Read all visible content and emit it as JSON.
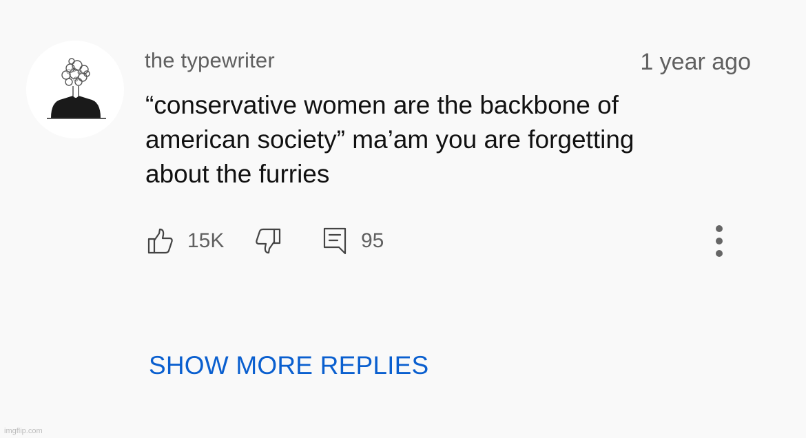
{
  "comment": {
    "author": "the typewriter",
    "timestamp": "1 year ago",
    "text_lines": [
      "“conservative women are the backbone of",
      "american society” ma’am you are forgetting",
      "about the furries"
    ],
    "avatar_icon": "avatar-sketch-icon"
  },
  "actions": {
    "like_icon": "thumbs-up-icon",
    "like_count": "15K",
    "dislike_icon": "thumbs-down-icon",
    "reply_icon": "comment-icon",
    "reply_count": "95",
    "menu_icon": "more-vertical-icon"
  },
  "show_more_replies_label": "SHOW MORE REPLIES",
  "watermark": "imgflip.com",
  "colors": {
    "background": "#f9f9f9",
    "secondary_text": "#606060",
    "primary_text": "#111111",
    "link": "#0a5fcf"
  }
}
